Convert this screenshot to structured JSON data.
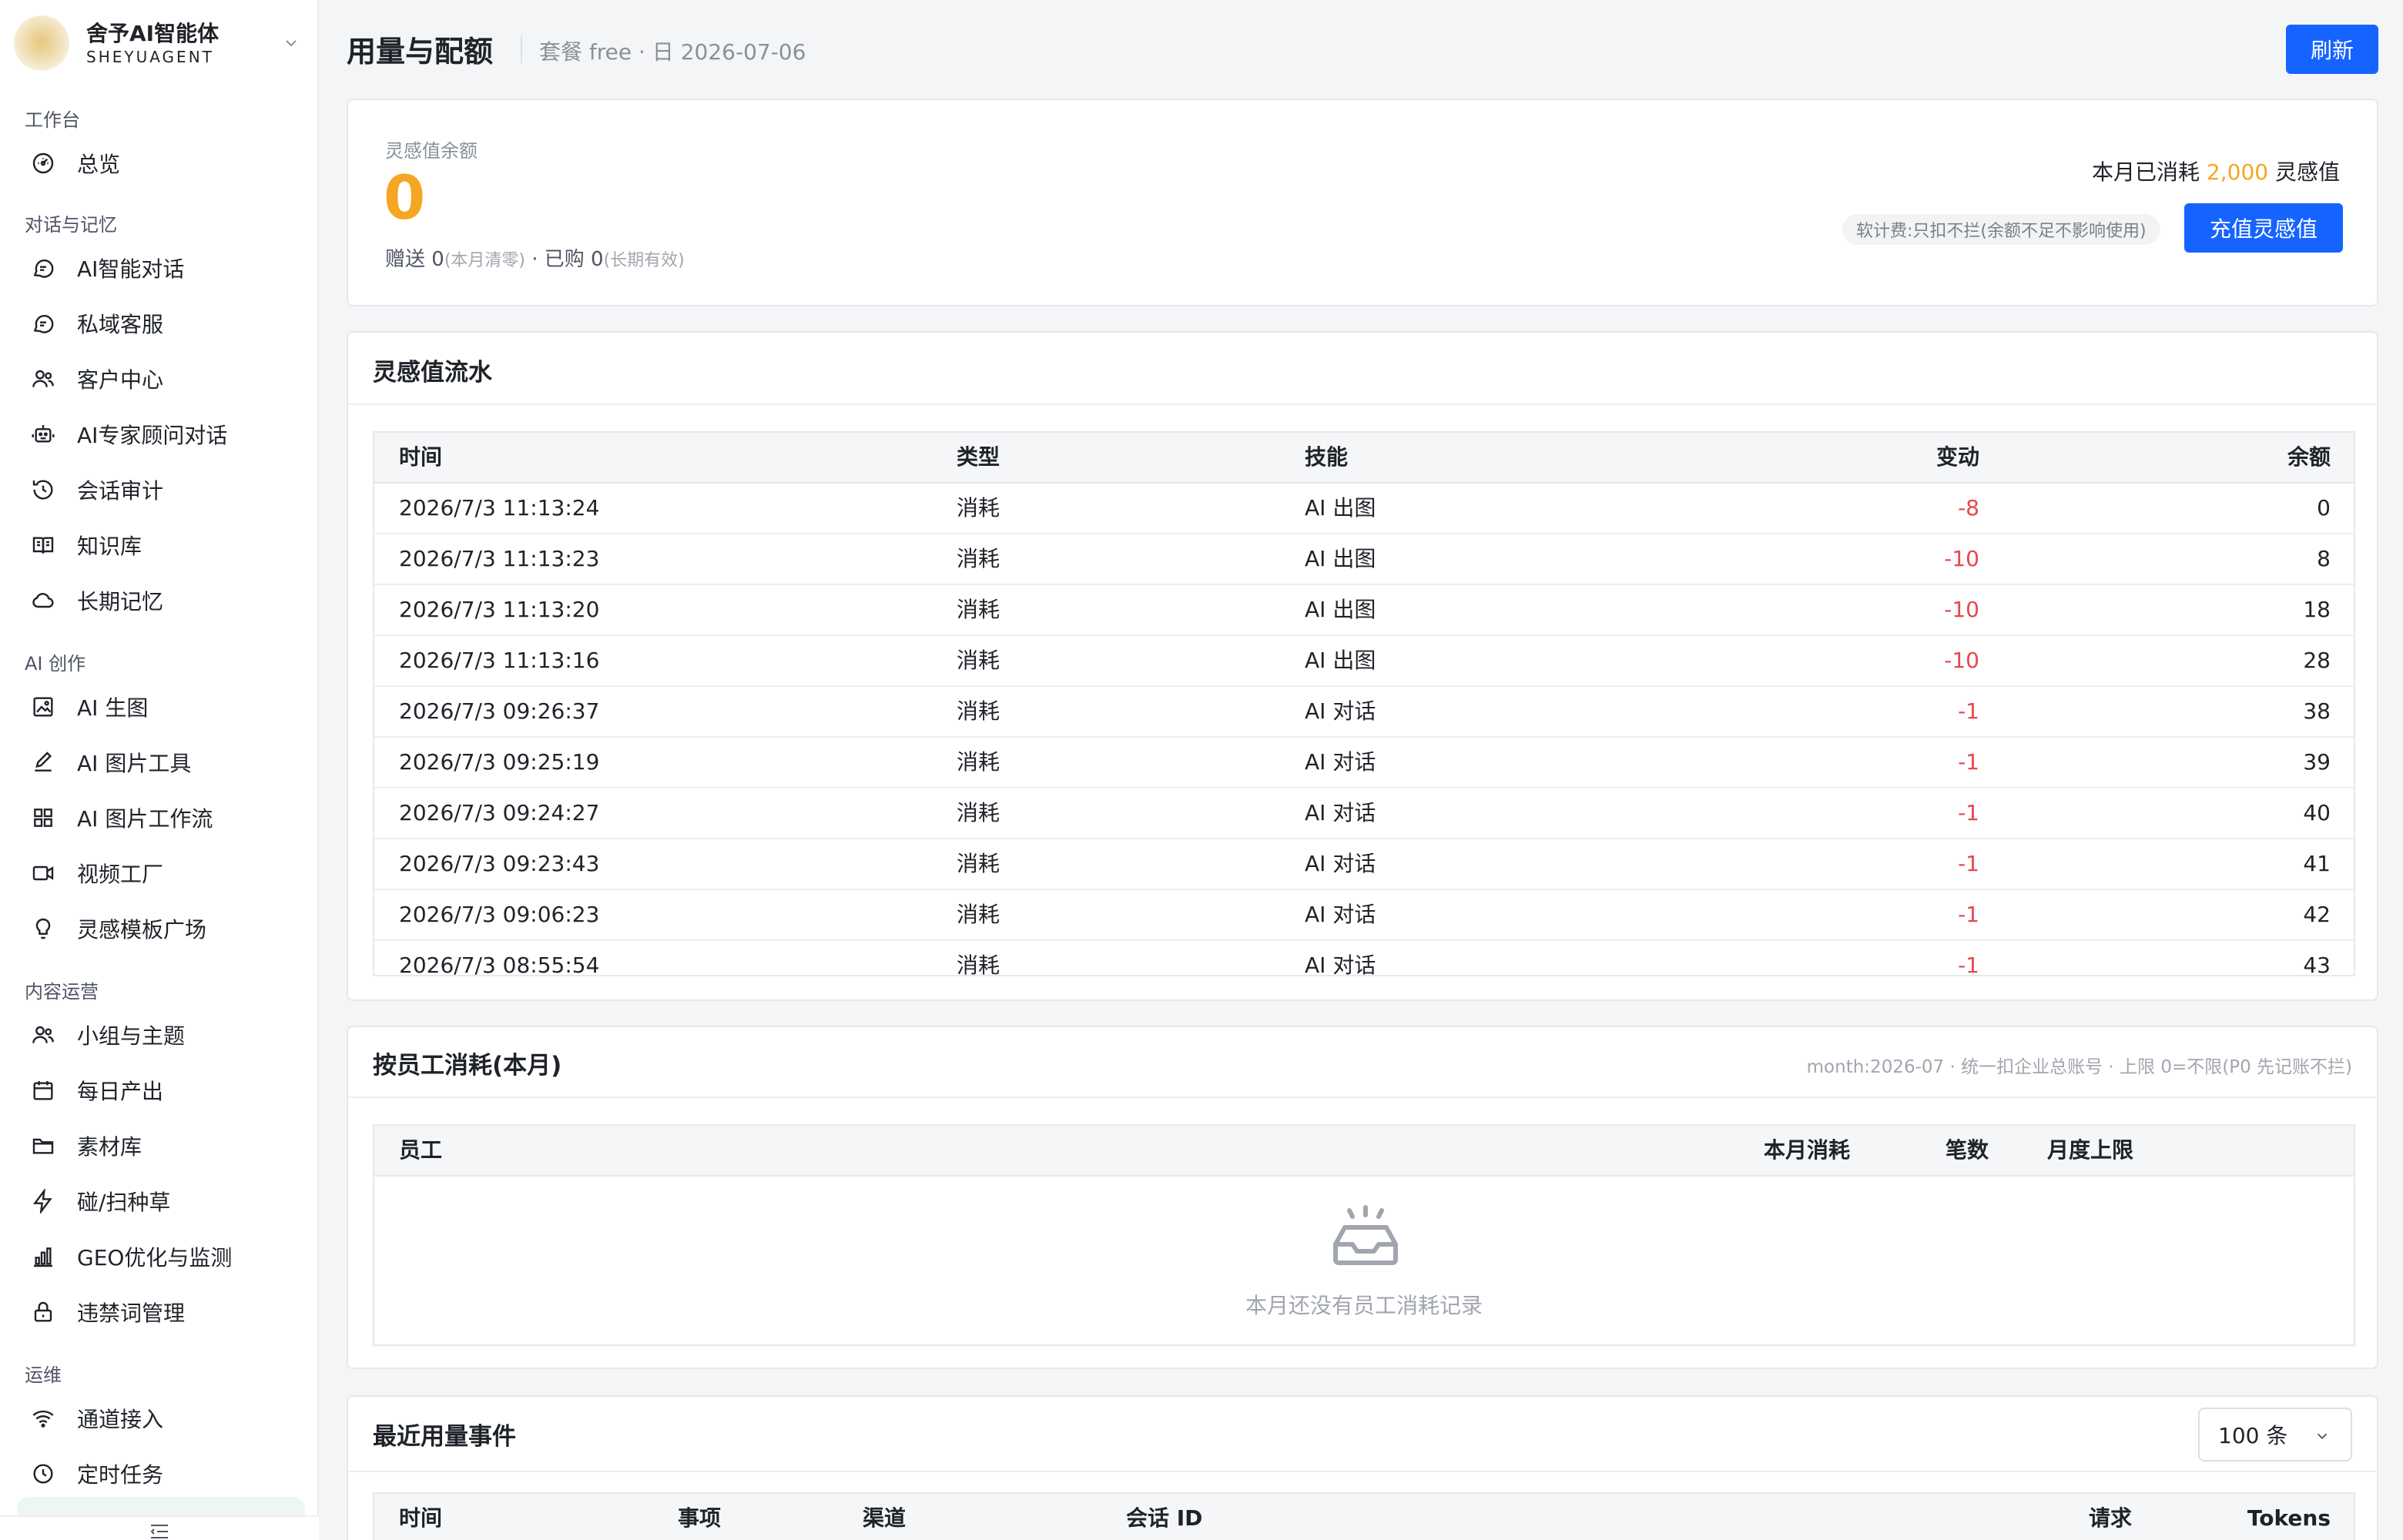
{
  "brand": {
    "name": "舍予AI智能体",
    "sub": "SHEYUAGENT"
  },
  "sidebar": {
    "groups": [
      {
        "label": "工作台",
        "items": [
          {
            "label": "总览",
            "icon": "dashboard-icon"
          }
        ]
      },
      {
        "label": "对话与记忆",
        "items": [
          {
            "label": "AI智能对话",
            "icon": "chat-icon"
          },
          {
            "label": "私域客服",
            "icon": "chat-icon"
          },
          {
            "label": "客户中心",
            "icon": "users-icon"
          },
          {
            "label": "AI专家顾问对话",
            "icon": "robot-icon"
          },
          {
            "label": "会话审计",
            "icon": "history-icon"
          },
          {
            "label": "知识库",
            "icon": "book-icon"
          },
          {
            "label": "长期记忆",
            "icon": "cloud-icon"
          }
        ]
      },
      {
        "label": "AI 创作",
        "items": [
          {
            "label": "AI 生图",
            "icon": "image-icon"
          },
          {
            "label": "AI 图片工具",
            "icon": "edit-icon"
          },
          {
            "label": "AI 图片工作流",
            "icon": "grid-icon"
          },
          {
            "label": "视频工厂",
            "icon": "video-icon"
          },
          {
            "label": "灵感模板广场",
            "icon": "bulb-icon"
          }
        ]
      },
      {
        "label": "内容运营",
        "items": [
          {
            "label": "小组与主题",
            "icon": "users-icon"
          },
          {
            "label": "每日产出",
            "icon": "calendar-icon"
          },
          {
            "label": "素材库",
            "icon": "folder-icon"
          },
          {
            "label": "碰/扫种草",
            "icon": "bolt-icon"
          },
          {
            "label": "GEO优化与监测",
            "icon": "bar-chart-icon"
          },
          {
            "label": "违禁词管理",
            "icon": "lock-icon"
          }
        ]
      },
      {
        "label": "运维",
        "items": [
          {
            "label": "通道接入",
            "icon": "wifi-icon"
          },
          {
            "label": "定时任务",
            "icon": "clock-icon"
          }
        ]
      }
    ]
  },
  "header": {
    "title": "用量与配额",
    "meta": "套餐 free · 日 2026-07-06",
    "refresh_label": "刷新"
  },
  "balance": {
    "label": "灵感值余额",
    "value": "0",
    "gift_label": "赠送 0",
    "gift_note": "(本月清零)",
    "sep": " · ",
    "bought_label": "已购 0",
    "bought_note": "(长期有效)",
    "month_used_prefix": "本月已消耗 ",
    "month_used_value": "2,000",
    "month_used_suffix": " 灵感值",
    "billing_note": "软计费:只扣不拦(余额不足不影响使用)",
    "recharge_label": "充值灵感值"
  },
  "ledger": {
    "title": "灵感值流水",
    "columns": [
      "时间",
      "类型",
      "技能",
      "变动",
      "余额"
    ],
    "rows": [
      {
        "time": "2026/7/3 11:13:24",
        "type": "消耗",
        "skill": "AI 出图",
        "delta": "-8",
        "balance": "0"
      },
      {
        "time": "2026/7/3 11:13:23",
        "type": "消耗",
        "skill": "AI 出图",
        "delta": "-10",
        "balance": "8"
      },
      {
        "time": "2026/7/3 11:13:20",
        "type": "消耗",
        "skill": "AI 出图",
        "delta": "-10",
        "balance": "18"
      },
      {
        "time": "2026/7/3 11:13:16",
        "type": "消耗",
        "skill": "AI 出图",
        "delta": "-10",
        "balance": "28"
      },
      {
        "time": "2026/7/3 09:26:37",
        "type": "消耗",
        "skill": "AI 对话",
        "delta": "-1",
        "balance": "38"
      },
      {
        "time": "2026/7/3 09:25:19",
        "type": "消耗",
        "skill": "AI 对话",
        "delta": "-1",
        "balance": "39"
      },
      {
        "time": "2026/7/3 09:24:27",
        "type": "消耗",
        "skill": "AI 对话",
        "delta": "-1",
        "balance": "40"
      },
      {
        "time": "2026/7/3 09:23:43",
        "type": "消耗",
        "skill": "AI 对话",
        "delta": "-1",
        "balance": "41"
      },
      {
        "time": "2026/7/3 09:06:23",
        "type": "消耗",
        "skill": "AI 对话",
        "delta": "-1",
        "balance": "42"
      },
      {
        "time": "2026/7/3 08:55:54",
        "type": "消耗",
        "skill": "AI 对话",
        "delta": "-1",
        "balance": "43"
      }
    ]
  },
  "staff": {
    "title": "按员工消耗(本月)",
    "note": "month:2026-07 · 统一扣企业总账号 · 上限 0=不限(P0 先记账不拦)",
    "columns": [
      "员工",
      "本月消耗",
      "笔数",
      "月度上限"
    ],
    "empty_text": "本月还没有员工消耗记录"
  },
  "events": {
    "title": "最近用量事件",
    "page_size": "100 条",
    "columns": [
      "时间",
      "事项",
      "渠道",
      "会话 ID",
      "请求",
      "Tokens"
    ]
  }
}
